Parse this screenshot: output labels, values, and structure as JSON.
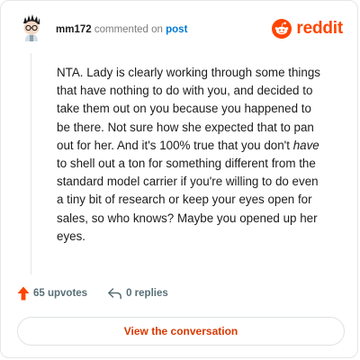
{
  "header": {
    "username": "mm172",
    "commented_on": "commented on",
    "post_link": "post"
  },
  "brand": {
    "wordmark": "reddit",
    "color": "#ff4500"
  },
  "comment": {
    "lines": [
      "NTA. Lady is clearly working through some things",
      "that have nothing to do with you, and decided to",
      "take them out on you because you happened to",
      "be there. Not sure how she expected that to pan",
      "out for her. And it's 100% true that you don't ",
      "have",
      "to shell out a ton for something different from the",
      "standard model carrier if you're willing to do even",
      "a tiny bit of research or keep your eyes open for",
      "sales, so who knows? Maybe you opened up her",
      "eyes."
    ]
  },
  "actions": {
    "upvotes": "65 upvotes",
    "replies": "0 replies"
  },
  "cta": {
    "label": "View the conversation"
  },
  "colors": {
    "upvote_arrow": "#ff4500",
    "link_blue": "#0079d3",
    "cta_text": "#d93900"
  },
  "icons": {
    "avatar": "avatar",
    "brand": "reddit-snoo-icon",
    "upvote": "upvote-arrow-icon",
    "reply": "reply-arrow-icon"
  }
}
